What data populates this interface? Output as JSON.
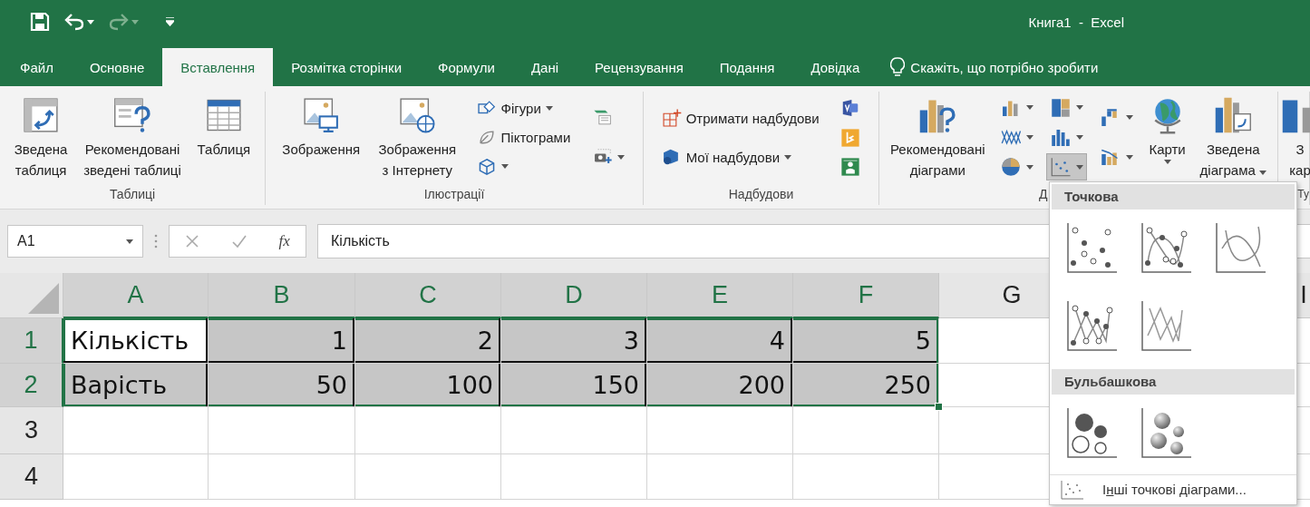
{
  "quick_access": [
    {
      "kind": "save",
      "disabled": false
    },
    {
      "kind": "undo",
      "disabled": false
    },
    {
      "kind": "redo",
      "disabled": true
    },
    {
      "kind": "customize",
      "disabled": false
    }
  ],
  "window": {
    "title": "Книга1  -  Excel"
  },
  "tabs": [
    {
      "label": "Файл",
      "selected": false
    },
    {
      "label": "Основне",
      "selected": false
    },
    {
      "label": "Вставлення",
      "selected": true
    },
    {
      "label": "Розмітка сторінки",
      "selected": false
    },
    {
      "label": "Формули",
      "selected": false
    },
    {
      "label": "Дані",
      "selected": false
    },
    {
      "label": "Рецензування",
      "selected": false
    },
    {
      "label": "Подання",
      "selected": false
    },
    {
      "label": "Довідка",
      "selected": false
    }
  ],
  "tell_me": "Скажіть, що потрібно зробити",
  "ribbon": {
    "groups": [
      {
        "label": "Таблиці",
        "columns": [
          {
            "kind": "large",
            "items": [
              {
                "lines": [
                  "Зведена",
                  "таблиця"
                ],
                "dropdown": false
              }
            ]
          },
          {
            "kind": "large",
            "items": [
              {
                "lines": [
                  "Рекомендовані",
                  "зведені таблиці"
                ],
                "dropdown": false
              }
            ]
          },
          {
            "kind": "large",
            "items": [
              {
                "lines": [
                  "Таблиця"
                ],
                "dropdown": false
              }
            ]
          }
        ]
      },
      {
        "label": "Ілюстрації",
        "columns": [
          {
            "kind": "large",
            "items": [
              {
                "lines": [
                  "Зображення"
                ],
                "dropdown": false
              }
            ]
          },
          {
            "kind": "large",
            "items": [
              {
                "lines": [
                  "Зображення",
                  "з Інтернету"
                ],
                "dropdown": false
              }
            ]
          },
          {
            "kind": "stack",
            "items": [
              {
                "label": "Фігури",
                "dropdown": true
              },
              {
                "label": "Піктограми",
                "dropdown": false
              },
              {
                "dropdown": true
              }
            ]
          },
          {
            "kind": "stack",
            "items": [
              {
                "dropdown": false
              },
              {
                "dropdown": true
              }
            ]
          }
        ]
      },
      {
        "label": "Надбудови",
        "columns": [
          {
            "kind": "stack",
            "items": [
              {
                "label": "Отримати надбудови",
                "dropdown": false
              },
              {
                "label": "Мої надбудови",
                "dropdown": true
              }
            ]
          },
          {
            "kind": "stack",
            "items": [
              {
                "dropdown": false
              },
              {
                "dropdown": false
              },
              {
                "dropdown": false
              }
            ]
          }
        ]
      },
      {
        "label": "Д",
        "columns": [
          {
            "kind": "large",
            "items": [
              {
                "lines": [
                  "Рекомендовані",
                  "діаграми"
                ],
                "dropdown": false
              }
            ]
          },
          {
            "kind": "charts",
            "items": [
              {
                "dropdown": true,
                "selected": false
              },
              {
                "dropdown": true,
                "selected": false
              },
              {
                "dropdown": true,
                "selected": false
              }
            ]
          },
          {
            "kind": "charts",
            "items": [
              {
                "dropdown": true,
                "selected": false
              },
              {
                "dropdown": true,
                "selected": false
              },
              {
                "dropdown": true,
                "selected": true
              }
            ]
          },
          {
            "kind": "charts",
            "items": [
              {
                "dropdown": true,
                "selected": false
              },
              {
                "dropdown": true,
                "selected": false
              }
            ]
          },
          {
            "kind": "large",
            "items": [
              {
                "lines": [
                  "Карти"
                ],
                "dropdown": true
              }
            ]
          },
          {
            "kind": "large",
            "items": [
              {
                "lines": [
                  "Зведена",
                  "діаграма"
                ],
                "dropdown": true
              }
            ]
          }
        ]
      },
      {
        "label": "Ту",
        "columns": [
          {
            "kind": "large",
            "items": [
              {
                "lines": [
                  "З",
                  "кар"
                ],
                "dropdown": false
              }
            ]
          }
        ]
      }
    ]
  },
  "formula_bar": {
    "name_box": "A1",
    "function_label": "fx",
    "formula": "Кількість"
  },
  "sheet": {
    "columns": [
      {
        "label": "A",
        "selected": true
      },
      {
        "label": "B",
        "selected": true
      },
      {
        "label": "C",
        "selected": true
      },
      {
        "label": "D",
        "selected": true
      },
      {
        "label": "E",
        "selected": true
      },
      {
        "label": "F",
        "selected": true
      },
      {
        "label": "G",
        "selected": false
      }
    ],
    "column_i": "I",
    "rows": [
      {
        "label": "1",
        "selected": true,
        "cells": [
          {
            "value": "Кількість",
            "kind": "text",
            "selected": true,
            "active": true
          },
          {
            "value": "1",
            "kind": "number",
            "selected": true,
            "active": false
          },
          {
            "value": "2",
            "kind": "number",
            "selected": true,
            "active": false
          },
          {
            "value": "3",
            "kind": "number",
            "selected": true,
            "active": false
          },
          {
            "value": "4",
            "kind": "number",
            "selected": true,
            "active": false
          },
          {
            "value": "5",
            "kind": "number",
            "selected": true,
            "active": false
          }
        ]
      },
      {
        "label": "2",
        "selected": true,
        "cells": [
          {
            "value": "Варість",
            "kind": "text",
            "selected": true,
            "active": false
          },
          {
            "value": "50",
            "kind": "number",
            "selected": true,
            "active": false
          },
          {
            "value": "100",
            "kind": "number",
            "selected": true,
            "active": false
          },
          {
            "value": "150",
            "kind": "number",
            "selected": true,
            "active": false
          },
          {
            "value": "200",
            "kind": "number",
            "selected": true,
            "active": false
          },
          {
            "value": "250",
            "kind": "number",
            "selected": true,
            "active": false
          }
        ]
      },
      {
        "label": "3",
        "selected": false
      },
      {
        "label": "4",
        "selected": false
      }
    ]
  },
  "chart_menu": {
    "sections": [
      {
        "title": "Точкова",
        "items": [
          {
            "kind": "markers"
          },
          {
            "kind": "smooth-markers"
          },
          {
            "kind": "smooth"
          },
          {
            "kind": "straight-markers"
          },
          {
            "kind": "straight"
          }
        ]
      },
      {
        "title": "Бульбашкова",
        "items": [
          {
            "kind": "bubble"
          },
          {
            "kind": "bubble-3d"
          }
        ]
      }
    ],
    "footer": {
      "before": "І",
      "key": "н",
      "after": "ші точкові діаграми..."
    }
  }
}
